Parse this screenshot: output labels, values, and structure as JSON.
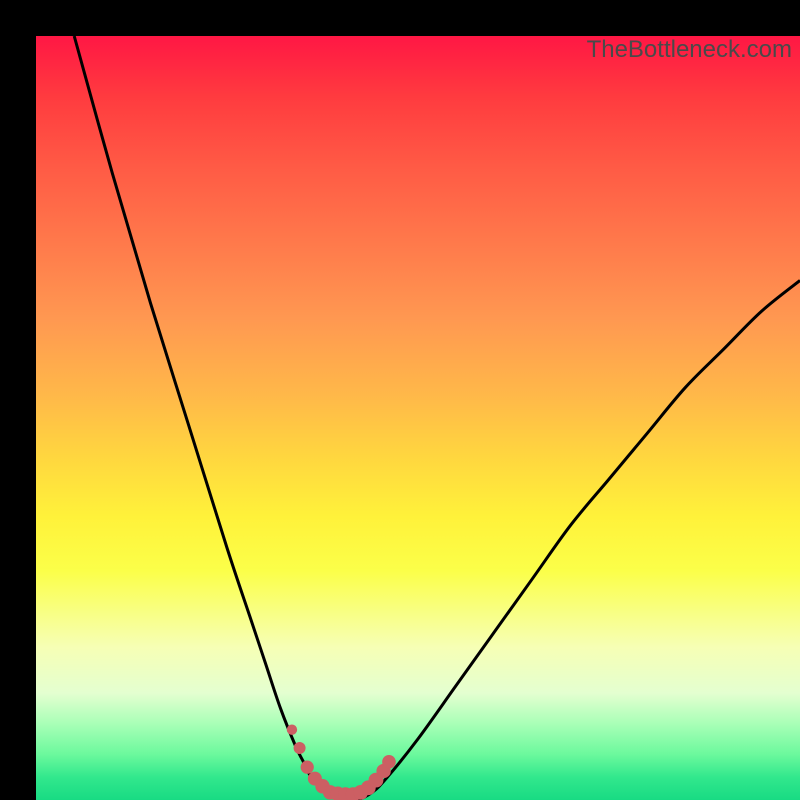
{
  "watermark": "TheBottleneck.com",
  "chart_data": {
    "type": "line",
    "title": "",
    "xlabel": "",
    "ylabel": "",
    "xlim": [
      0,
      100
    ],
    "ylim": [
      0,
      100
    ],
    "grid": false,
    "series": [
      {
        "name": "curve",
        "x": [
          5,
          10,
          15,
          20,
          25,
          28,
          30,
          32,
          34,
          35,
          36,
          37,
          38,
          40,
          42,
          44,
          46,
          50,
          55,
          60,
          65,
          70,
          75,
          80,
          85,
          90,
          95,
          100
        ],
        "values": [
          100,
          82,
          65,
          49,
          33,
          24,
          18,
          12,
          7,
          5,
          3,
          2,
          1,
          0,
          0,
          1,
          3,
          8,
          15,
          22,
          29,
          36,
          42,
          48,
          54,
          59,
          64,
          68
        ]
      }
    ],
    "markers": {
      "name": "highlight-dots",
      "color": "#cc5f63",
      "x": [
        33.5,
        34.5,
        35.5,
        36.5,
        37.5,
        38.5,
        39.5,
        40.5,
        41.5,
        42.5,
        43.5,
        44.5,
        45.5,
        46.2
      ],
      "values": [
        9.2,
        6.8,
        4.3,
        2.8,
        1.8,
        1.0,
        0.8,
        0.7,
        0.7,
        1.0,
        1.6,
        2.6,
        3.8,
        5.0
      ],
      "radius": [
        5.2,
        6.0,
        6.6,
        7.0,
        7.2,
        7.2,
        7.4,
        7.4,
        7.4,
        7.4,
        7.4,
        7.4,
        7.2,
        6.8
      ]
    }
  }
}
